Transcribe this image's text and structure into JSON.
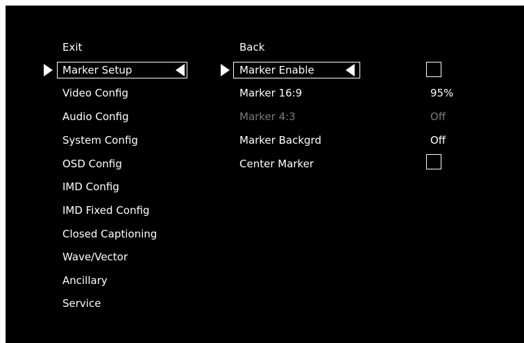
{
  "main_menu": {
    "items": [
      {
        "label": "Exit"
      },
      {
        "label": "Marker Setup"
      },
      {
        "label": "Video Config"
      },
      {
        "label": "Audio Config"
      },
      {
        "label": "System Config"
      },
      {
        "label": "OSD Config"
      },
      {
        "label": "IMD Config"
      },
      {
        "label": "IMD Fixed Config"
      },
      {
        "label": "Closed Captioning"
      },
      {
        "label": "Wave/Vector"
      },
      {
        "label": "Ancillary"
      },
      {
        "label": "Service"
      }
    ],
    "selected": "Marker Setup"
  },
  "sub_menu": {
    "items": [
      {
        "label": "Back",
        "value": ""
      },
      {
        "label": "Marker Enable",
        "value": "",
        "control": "checkbox",
        "checked": false
      },
      {
        "label": "Marker 16:9",
        "value": "95%"
      },
      {
        "label": "Marker 4:3",
        "value": "Off",
        "disabled": true
      },
      {
        "label": "Marker Backgrd",
        "value": "Off"
      },
      {
        "label": "Center Marker",
        "value": "",
        "control": "checkbox",
        "checked": false
      }
    ],
    "selected": "Marker Enable"
  },
  "colors": {
    "background": "#000000",
    "text": "#ffffff",
    "disabled_text": "#7a7a7a",
    "border": "#ffffff"
  }
}
